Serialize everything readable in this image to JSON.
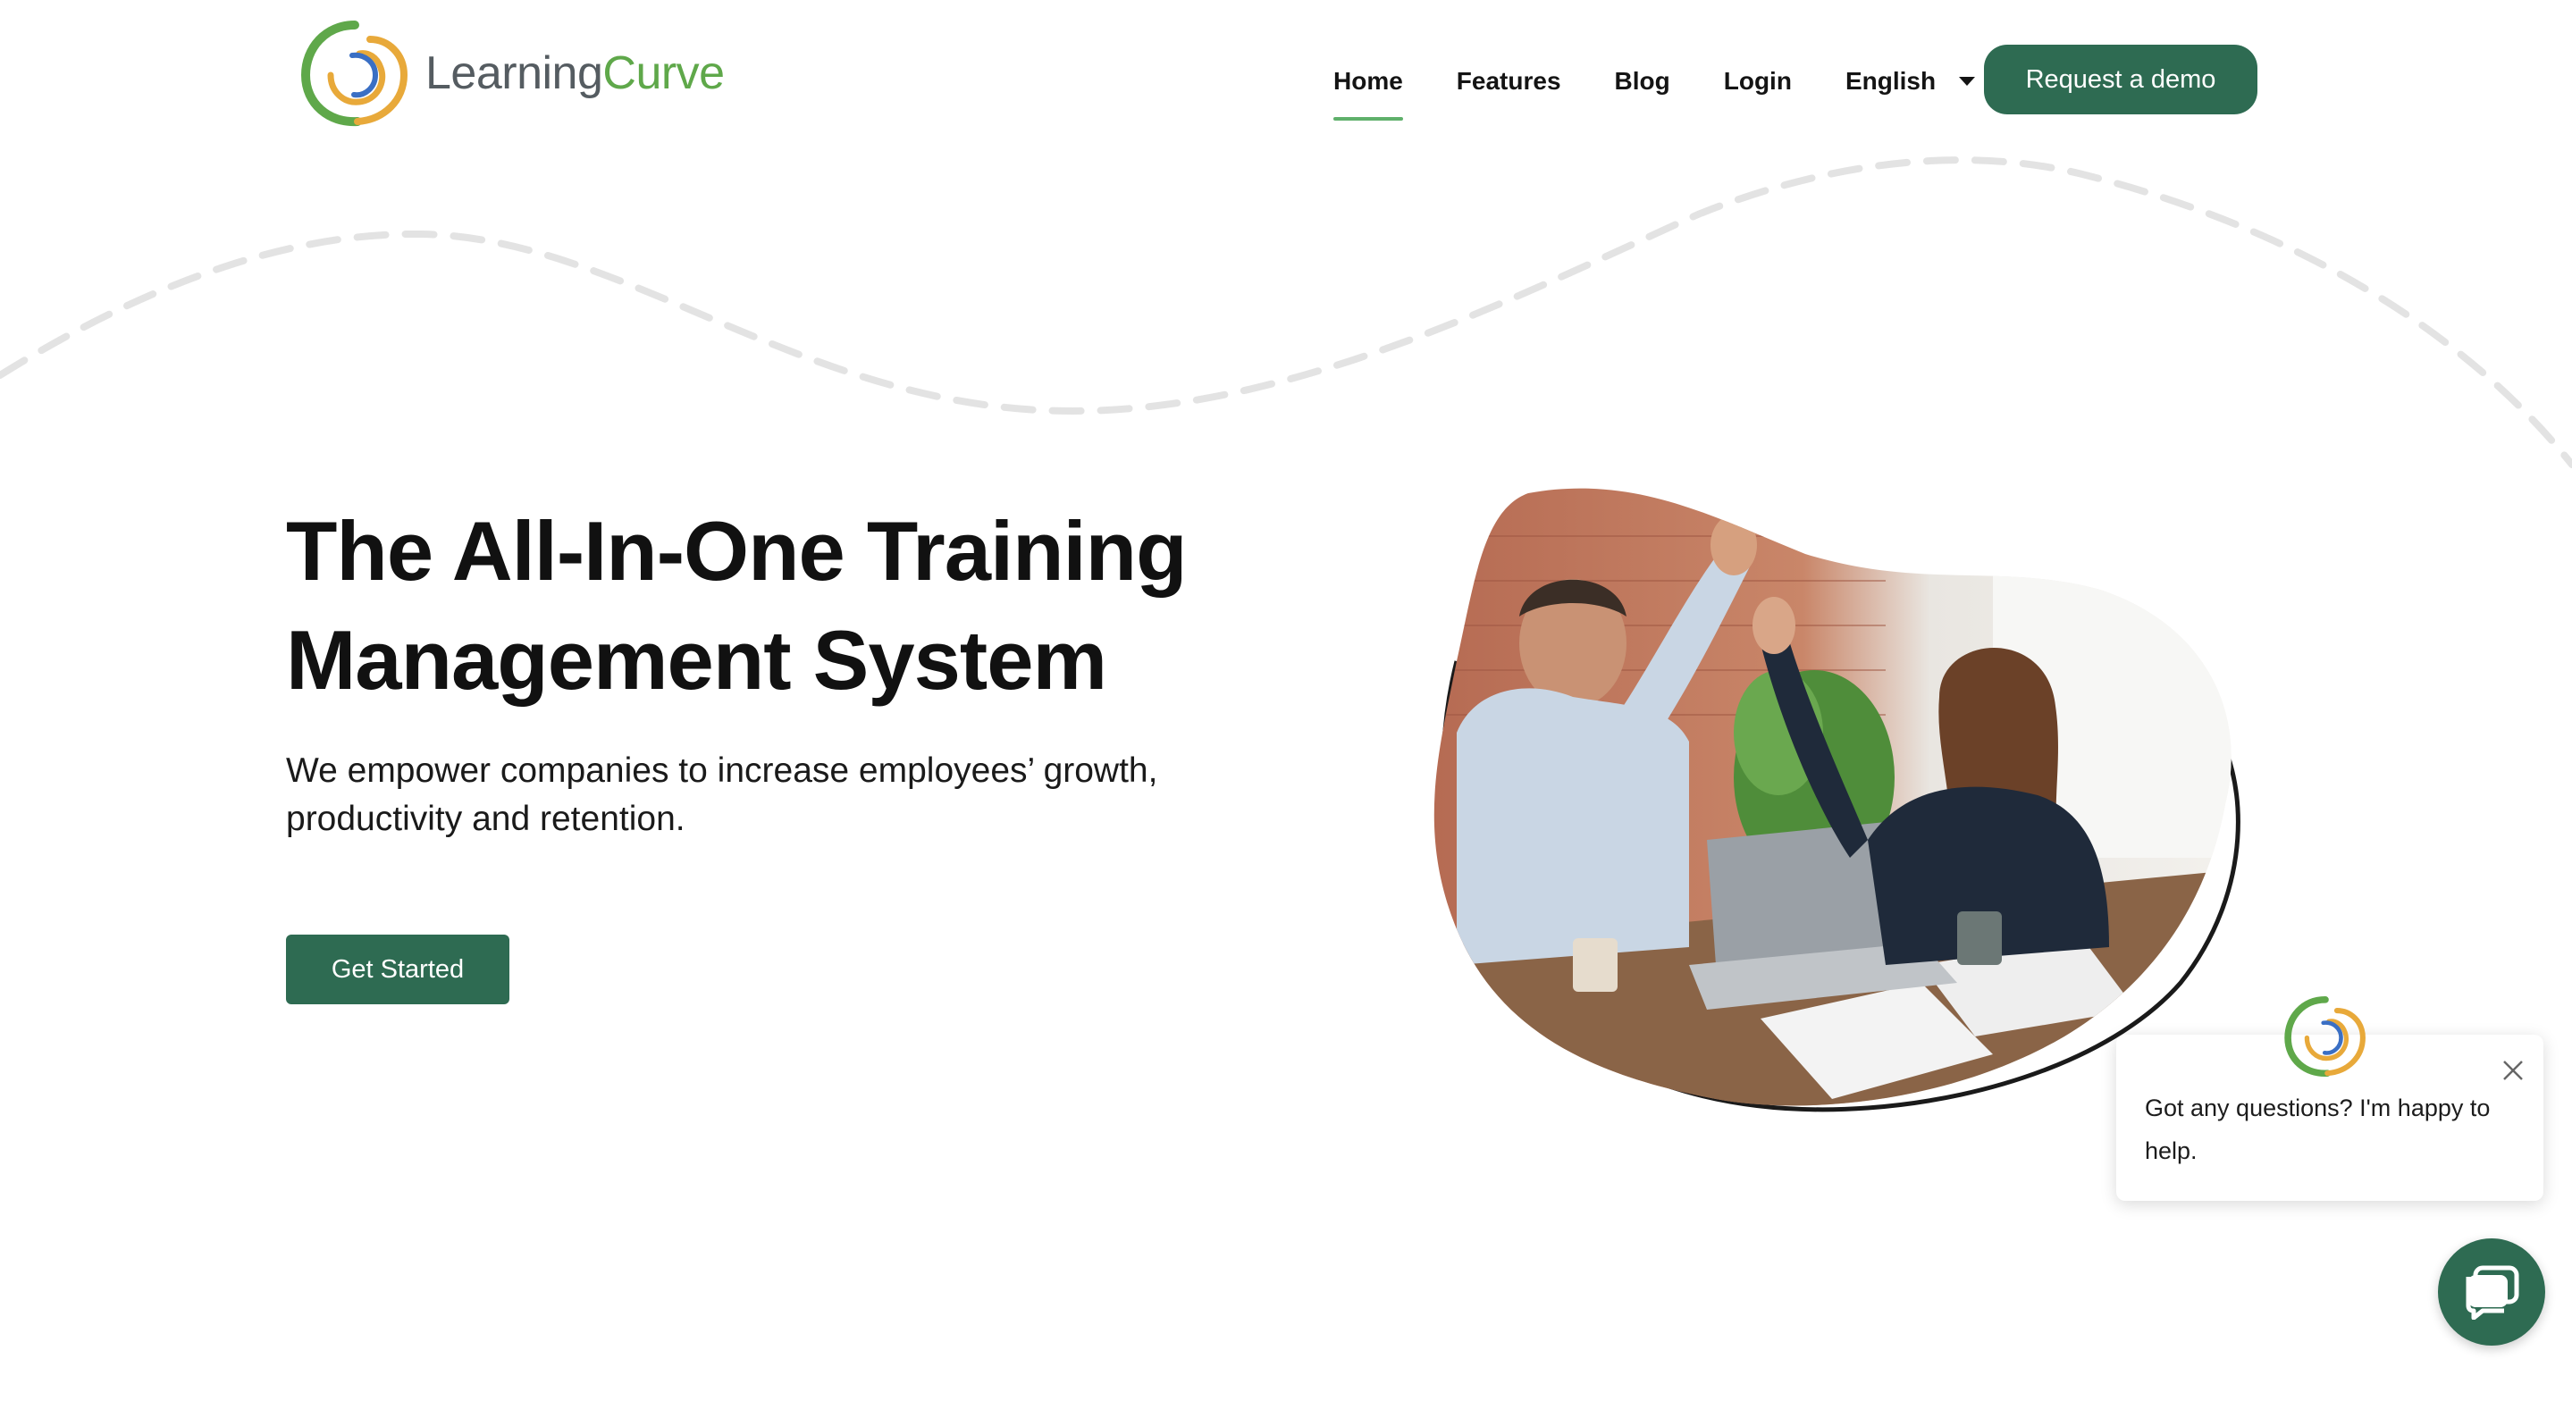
{
  "header": {
    "logo": {
      "name_part1": "Learning",
      "name_part2": "Curve",
      "icon": "spiral-logo-icon"
    },
    "nav": [
      {
        "label": "Home",
        "active": true
      },
      {
        "label": "Features"
      },
      {
        "label": "Blog"
      },
      {
        "label": "Login"
      }
    ],
    "language": {
      "label": "English",
      "icon": "caret-down-icon"
    },
    "demo_button": "Request a demo"
  },
  "hero": {
    "title_line1": "The All-In-One Training",
    "title_line2": "Management System",
    "subtitle_line1": "We empower companies to increase employees’ growth,",
    "subtitle_line2": "productivity and retention.",
    "cta": "Get Started",
    "image": "two-colleagues-high-five-photo"
  },
  "chat": {
    "message": "Got any questions? I'm happy to help.",
    "close_icon": "close-icon",
    "launcher_icon": "chat-icon"
  },
  "colors": {
    "brand_green": "#2e6b52",
    "logo_green": "#5fa84a",
    "logo_orange": "#e8a93a",
    "logo_blue": "#3a6fc4",
    "active_underline": "#5fb06b"
  }
}
